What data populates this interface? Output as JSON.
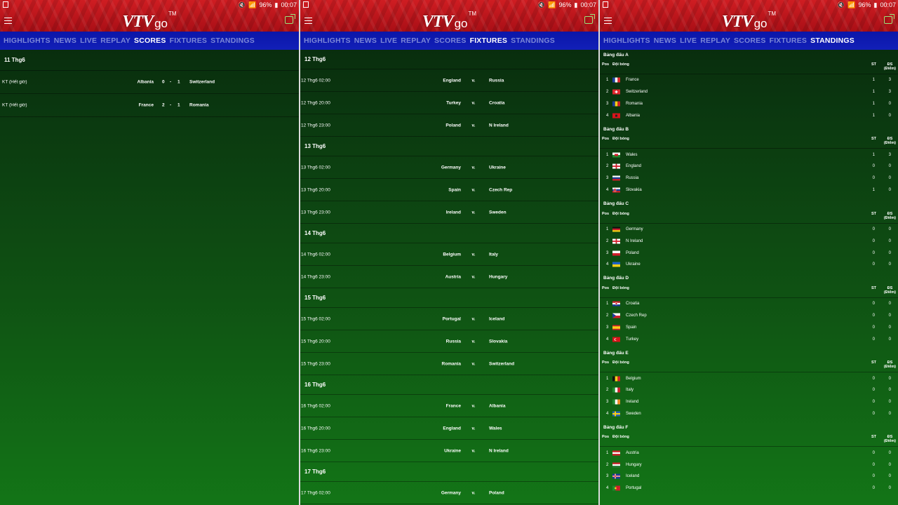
{
  "status_bar": {
    "battery": "96%",
    "time": "00:07"
  },
  "app": {
    "logo_text": "VTV",
    "logo_suffix": "go",
    "logo_mark": "TM"
  },
  "colors": {
    "header_red": "#c2151d",
    "nav_blue": "#0f1bb0",
    "nav_inactive": "#7b87d8",
    "background_green": "#0f5213"
  },
  "nav_items": [
    "HIGHLIGHTS",
    "NEWS",
    "LIVE",
    "REPLAY",
    "SCORES",
    "FIXTURES",
    "STANDINGS"
  ],
  "panels": [
    {
      "active_tab": "SCORES"
    },
    {
      "active_tab": "FIXTURES"
    },
    {
      "active_tab": "STANDINGS"
    }
  ],
  "scores": {
    "date": "11 Thg6",
    "matches": [
      {
        "status": "KT (Hết giờ)",
        "home": "Albania",
        "home_score": "0",
        "dash": "-",
        "away_score": "1",
        "away": "Switzerland"
      },
      {
        "status": "KT (Hết giờ)",
        "home": "France",
        "home_score": "2",
        "dash": "-",
        "away_score": "1",
        "away": "Romania"
      }
    ]
  },
  "fixtures": {
    "vs_label": "v.",
    "days": [
      {
        "date": "12 Thg6",
        "matches": [
          {
            "time": "12 Thg6 02:00",
            "home": "England",
            "away": "Russia"
          },
          {
            "time": "12 Thg6 20:00",
            "home": "Turkey",
            "away": "Croatia"
          },
          {
            "time": "12 Thg6 23:00",
            "home": "Poland",
            "away": "N Ireland"
          }
        ]
      },
      {
        "date": "13 Thg6",
        "matches": [
          {
            "time": "13 Thg6 02:00",
            "home": "Germany",
            "away": "Ukraine"
          },
          {
            "time": "13 Thg6 20:00",
            "home": "Spain",
            "away": "Czech Rep"
          },
          {
            "time": "13 Thg6 23:00",
            "home": "Ireland",
            "away": "Sweden"
          }
        ]
      },
      {
        "date": "14 Thg6",
        "matches": [
          {
            "time": "14 Thg6 02:00",
            "home": "Belgium",
            "away": "Italy"
          },
          {
            "time": "14 Thg6 23:00",
            "home": "Austria",
            "away": "Hungary"
          }
        ]
      },
      {
        "date": "15 Thg6",
        "matches": [
          {
            "time": "15 Thg6 02:00",
            "home": "Portugal",
            "away": "Iceland"
          },
          {
            "time": "15 Thg6 20:00",
            "home": "Russia",
            "away": "Slovakia"
          },
          {
            "time": "15 Thg6 23:00",
            "home": "Romania",
            "away": "Switzerland"
          }
        ]
      },
      {
        "date": "16 Thg6",
        "matches": [
          {
            "time": "16 Thg6 02:00",
            "home": "France",
            "away": "Albania"
          },
          {
            "time": "16 Thg6 20:00",
            "home": "England",
            "away": "Wales"
          },
          {
            "time": "16 Thg6 23:00",
            "home": "Ukraine",
            "away": "N Ireland"
          }
        ]
      },
      {
        "date": "17 Thg6",
        "matches": [
          {
            "time": "17 Thg6 02:00",
            "home": "Germany",
            "away": "Poland"
          }
        ]
      }
    ]
  },
  "standings": {
    "headers": {
      "pos": "Pos",
      "team": "Đội bóng",
      "played": "ST",
      "points": "ĐS",
      "points_sub": "(Điểm)"
    },
    "groups": [
      {
        "title": "Bảng đấu A",
        "teams": [
          {
            "pos": "1",
            "name": "France",
            "flag": "france",
            "played": "1",
            "points": "3"
          },
          {
            "pos": "2",
            "name": "Switzerland",
            "flag": "switzerland",
            "played": "1",
            "points": "3"
          },
          {
            "pos": "3",
            "name": "Romania",
            "flag": "romania",
            "played": "1",
            "points": "0"
          },
          {
            "pos": "4",
            "name": "Albania",
            "flag": "albania",
            "played": "1",
            "points": "0"
          }
        ]
      },
      {
        "title": "Bảng đấu B",
        "teams": [
          {
            "pos": "1",
            "name": "Wales",
            "flag": "wales",
            "played": "1",
            "points": "3"
          },
          {
            "pos": "2",
            "name": "England",
            "flag": "england",
            "played": "0",
            "points": "0"
          },
          {
            "pos": "3",
            "name": "Russia",
            "flag": "russia",
            "played": "0",
            "points": "0"
          },
          {
            "pos": "4",
            "name": "Slovakia",
            "flag": "slovakia",
            "played": "1",
            "points": "0"
          }
        ]
      },
      {
        "title": "Bảng đấu C",
        "teams": [
          {
            "pos": "1",
            "name": "Germany",
            "flag": "germany",
            "played": "0",
            "points": "0"
          },
          {
            "pos": "2",
            "name": "N Ireland",
            "flag": "n-ireland",
            "played": "0",
            "points": "0"
          },
          {
            "pos": "3",
            "name": "Poland",
            "flag": "poland",
            "played": "0",
            "points": "0"
          },
          {
            "pos": "4",
            "name": "Ukraine",
            "flag": "ukraine",
            "played": "0",
            "points": "0"
          }
        ]
      },
      {
        "title": "Bảng đấu D",
        "teams": [
          {
            "pos": "1",
            "name": "Croatia",
            "flag": "croatia",
            "played": "0",
            "points": "0"
          },
          {
            "pos": "2",
            "name": "Czech Rep",
            "flag": "czech-rep",
            "played": "0",
            "points": "0"
          },
          {
            "pos": "3",
            "name": "Spain",
            "flag": "spain",
            "played": "0",
            "points": "0"
          },
          {
            "pos": "4",
            "name": "Turkey",
            "flag": "turkey",
            "played": "0",
            "points": "0"
          }
        ]
      },
      {
        "title": "Bảng đấu E",
        "teams": [
          {
            "pos": "1",
            "name": "Belgium",
            "flag": "belgium",
            "played": "0",
            "points": "0"
          },
          {
            "pos": "2",
            "name": "Italy",
            "flag": "italy",
            "played": "0",
            "points": "0"
          },
          {
            "pos": "3",
            "name": "Ireland",
            "flag": "ireland",
            "played": "0",
            "points": "0"
          },
          {
            "pos": "4",
            "name": "Sweden",
            "flag": "sweden",
            "played": "0",
            "points": "0"
          }
        ]
      },
      {
        "title": "Bảng đấu F",
        "teams": [
          {
            "pos": "1",
            "name": "Austria",
            "flag": "austria",
            "played": "0",
            "points": "0"
          },
          {
            "pos": "2",
            "name": "Hungary",
            "flag": "hungary",
            "played": "0",
            "points": "0"
          },
          {
            "pos": "3",
            "name": "Iceland",
            "flag": "iceland",
            "played": "0",
            "points": "0"
          },
          {
            "pos": "4",
            "name": "Portugal",
            "flag": "portugal",
            "played": "0",
            "points": "0"
          }
        ]
      }
    ]
  }
}
